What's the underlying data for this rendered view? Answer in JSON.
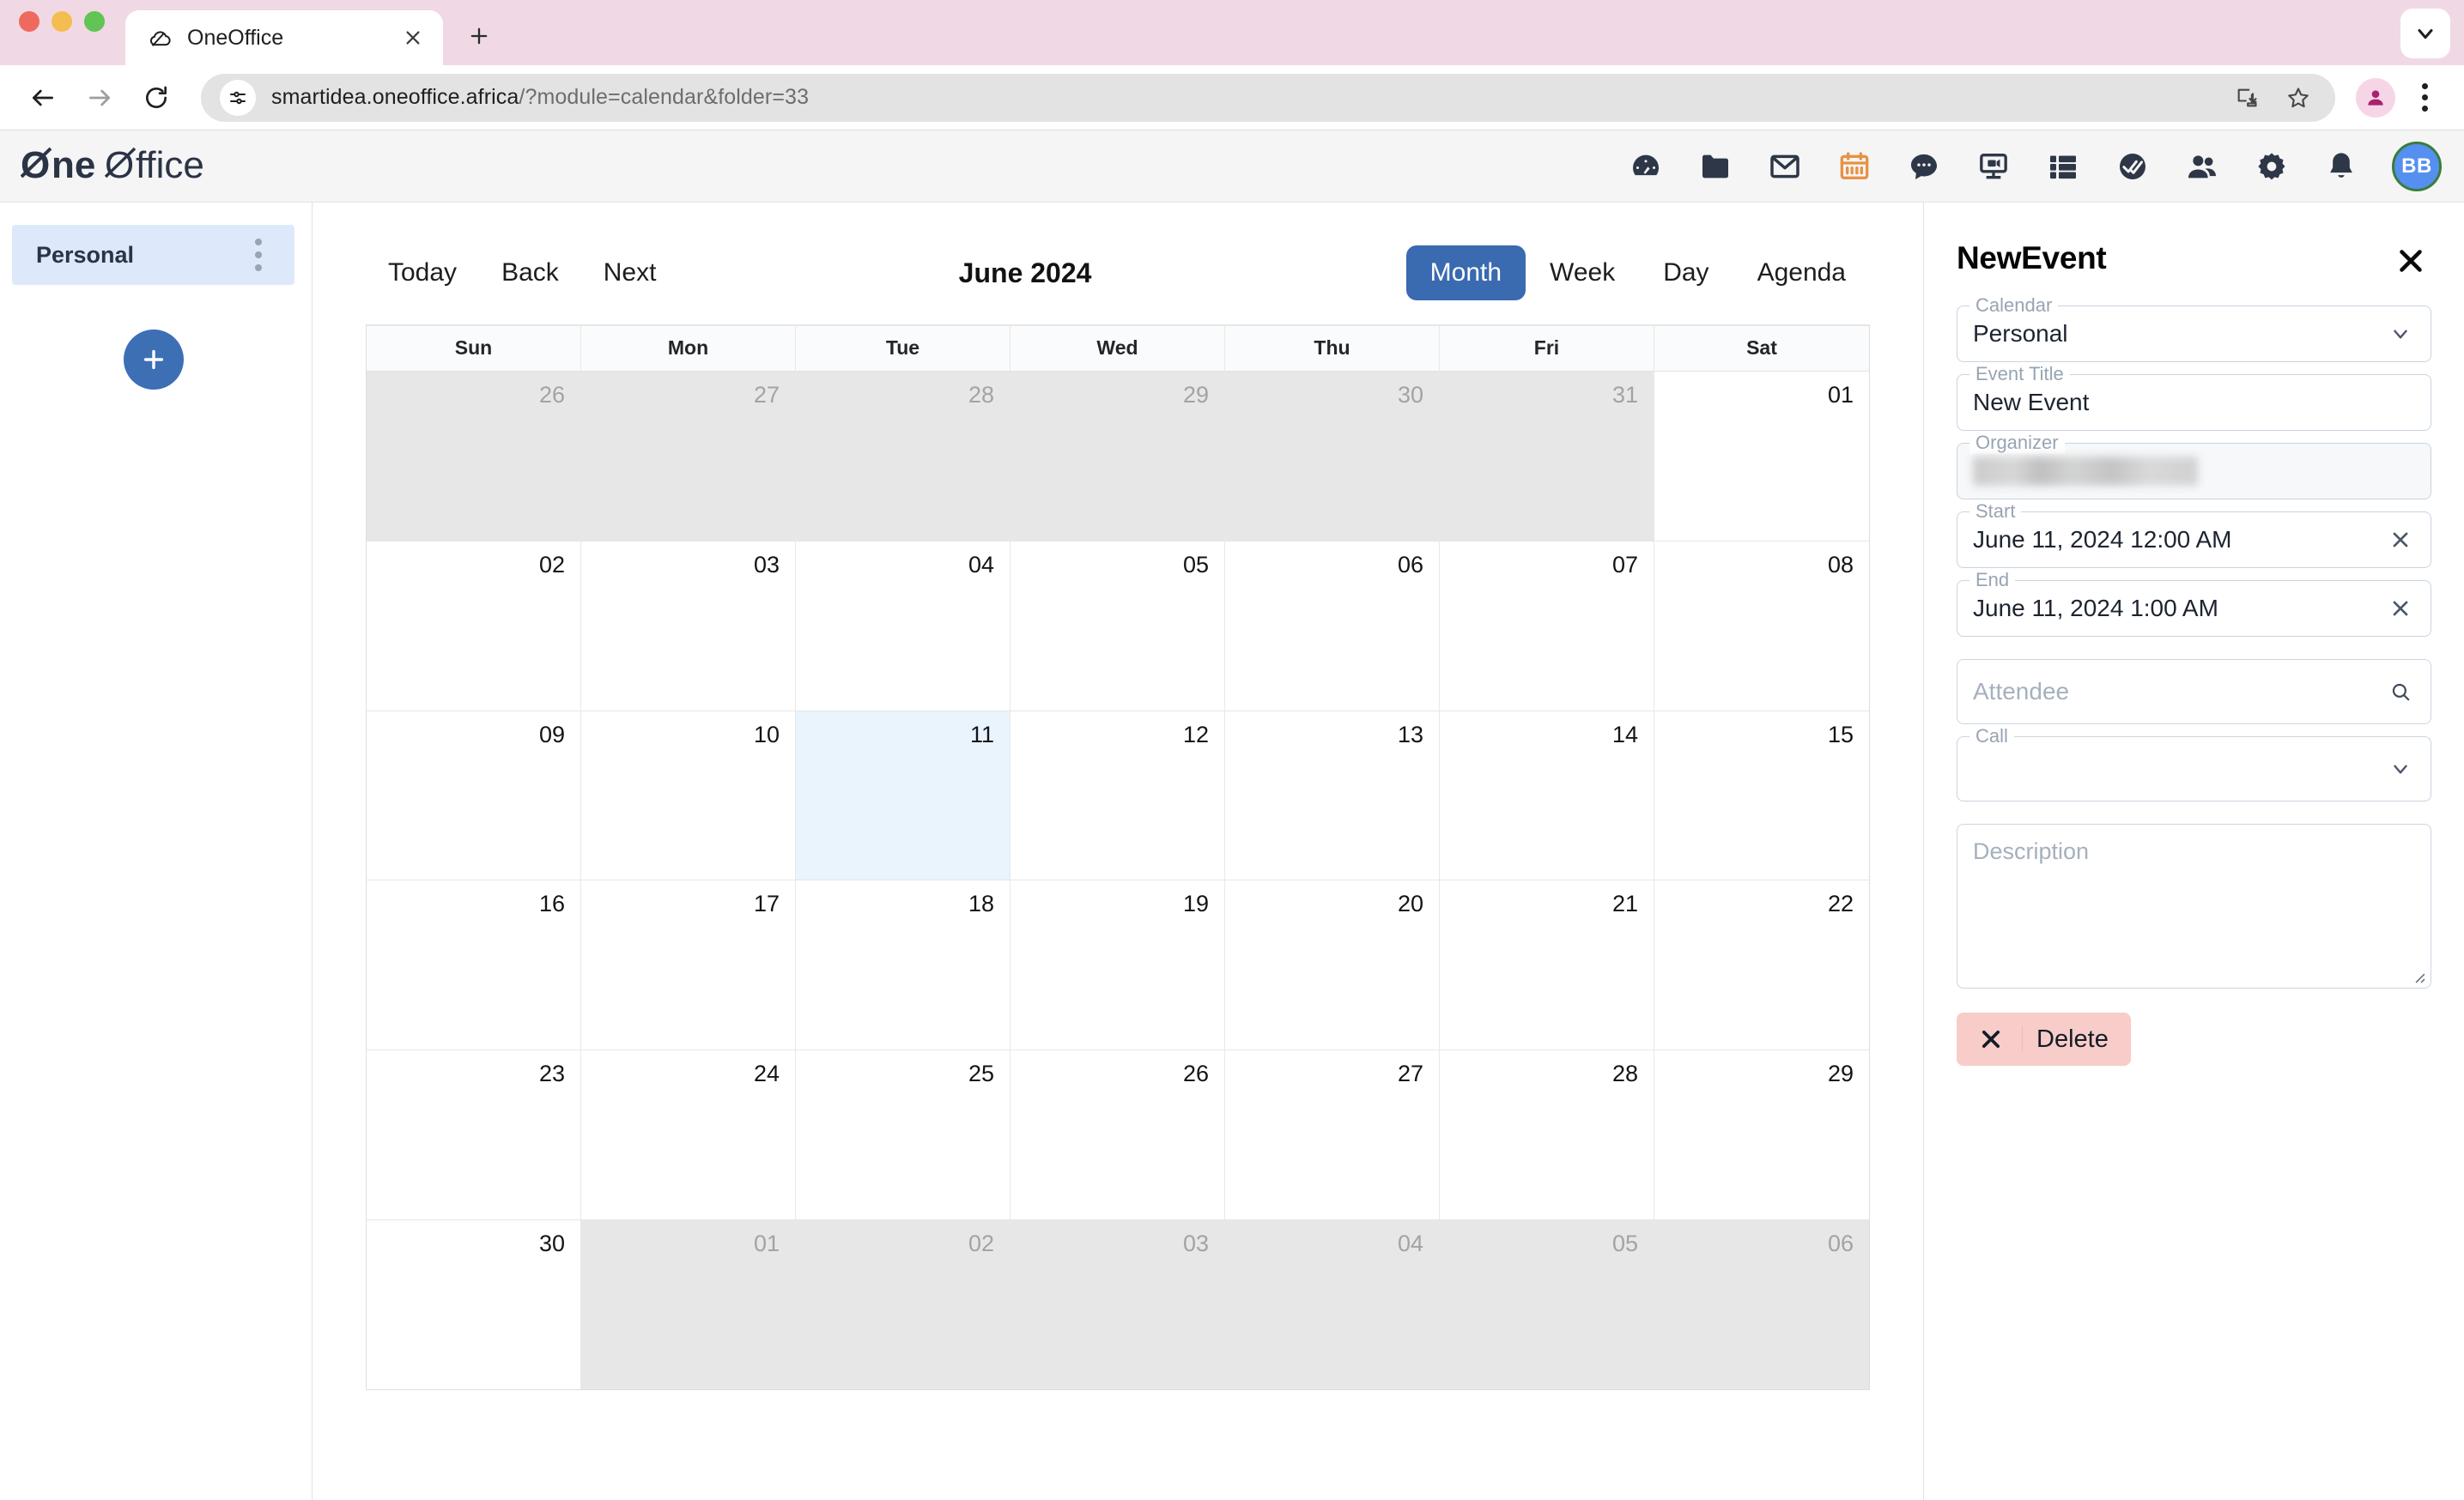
{
  "browser": {
    "tab": {
      "title": "OneOffice",
      "favicon_icon": "cloud-slash-icon",
      "close_icon": "close-icon"
    },
    "new_tab_icon": "plus-icon",
    "tab_list_icon": "chevron-down-icon",
    "back_icon": "arrow-left-icon",
    "forward_icon": "arrow-right-icon",
    "reload_icon": "reload-icon",
    "site_info_icon": "tune-icon",
    "url": {
      "domain": "smartidea.oneoffice.africa",
      "rest": "/?module=calendar&folder=33"
    },
    "install_icon": "install-app-icon",
    "bookmark_icon": "star-icon",
    "profile_icon": "person-icon",
    "menu_icon": "kebab-menu-icon"
  },
  "app_header": {
    "brand": "OneOffice",
    "icons": [
      {
        "name": "dashboard-icon",
        "label": "Dashboard",
        "active": false
      },
      {
        "name": "files-icon",
        "label": "Files",
        "active": false
      },
      {
        "name": "mail-icon",
        "label": "Mail",
        "active": false
      },
      {
        "name": "calendar-icon",
        "label": "Calendar",
        "active": true
      },
      {
        "name": "chat-icon",
        "label": "Chat",
        "active": false
      },
      {
        "name": "webinar-icon",
        "label": "Webinar",
        "active": false
      },
      {
        "name": "boards-icon",
        "label": "Boards",
        "active": false
      },
      {
        "name": "tasks-done-icon",
        "label": "Tasks",
        "active": false
      },
      {
        "name": "contacts-icon",
        "label": "Contacts",
        "active": false
      },
      {
        "name": "settings-icon",
        "label": "Settings",
        "active": false
      },
      {
        "name": "notifications-icon",
        "label": "Notifications",
        "active": false
      }
    ],
    "avatar_initials": "BB"
  },
  "sidebar": {
    "calendars": [
      {
        "label": "Personal",
        "selected": true,
        "menu_icon": "kebab-menu-icon"
      }
    ],
    "add_button_icon": "plus-icon"
  },
  "calendar": {
    "toolbar": {
      "today": "Today",
      "back": "Back",
      "next": "Next",
      "title": "June 2024",
      "views": [
        {
          "label": "Month",
          "active": true
        },
        {
          "label": "Week",
          "active": false
        },
        {
          "label": "Day",
          "active": false
        },
        {
          "label": "Agenda",
          "active": false
        }
      ]
    },
    "day_headers": [
      "Sun",
      "Mon",
      "Tue",
      "Wed",
      "Thu",
      "Fri",
      "Sat"
    ],
    "weeks": [
      [
        {
          "d": "26",
          "off": true
        },
        {
          "d": "27",
          "off": true
        },
        {
          "d": "28",
          "off": true
        },
        {
          "d": "29",
          "off": true
        },
        {
          "d": "30",
          "off": true
        },
        {
          "d": "31",
          "off": true
        },
        {
          "d": "01",
          "off": false
        }
      ],
      [
        {
          "d": "02",
          "off": false
        },
        {
          "d": "03",
          "off": false
        },
        {
          "d": "04",
          "off": false
        },
        {
          "d": "05",
          "off": false
        },
        {
          "d": "06",
          "off": false
        },
        {
          "d": "07",
          "off": false
        },
        {
          "d": "08",
          "off": false
        }
      ],
      [
        {
          "d": "09",
          "off": false
        },
        {
          "d": "10",
          "off": false
        },
        {
          "d": "11",
          "off": false,
          "today": true
        },
        {
          "d": "12",
          "off": false
        },
        {
          "d": "13",
          "off": false
        },
        {
          "d": "14",
          "off": false
        },
        {
          "d": "15",
          "off": false
        }
      ],
      [
        {
          "d": "16",
          "off": false
        },
        {
          "d": "17",
          "off": false
        },
        {
          "d": "18",
          "off": false
        },
        {
          "d": "19",
          "off": false
        },
        {
          "d": "20",
          "off": false
        },
        {
          "d": "21",
          "off": false
        },
        {
          "d": "22",
          "off": false
        }
      ],
      [
        {
          "d": "23",
          "off": false
        },
        {
          "d": "24",
          "off": false
        },
        {
          "d": "25",
          "off": false
        },
        {
          "d": "26",
          "off": false
        },
        {
          "d": "27",
          "off": false
        },
        {
          "d": "28",
          "off": false
        },
        {
          "d": "29",
          "off": false
        }
      ],
      [
        {
          "d": "30",
          "off": false
        },
        {
          "d": "01",
          "off": true
        },
        {
          "d": "02",
          "off": true
        },
        {
          "d": "03",
          "off": true
        },
        {
          "d": "04",
          "off": true
        },
        {
          "d": "05",
          "off": true
        },
        {
          "d": "06",
          "off": true
        }
      ]
    ]
  },
  "event_panel": {
    "title": "NewEvent",
    "close_icon": "close-icon",
    "calendar_label": "Calendar",
    "calendar_value": "Personal",
    "calendar_dropdown_icon": "chevron-down-icon",
    "event_title_label": "Event Title",
    "event_title_value": "New Event",
    "organizer_label": "Organizer",
    "organizer_value": "",
    "start_label": "Start",
    "start_value": "June 11, 2024 12:00 AM",
    "start_clear_icon": "close-icon",
    "end_label": "End",
    "end_value": "June 11, 2024 1:00 AM",
    "end_clear_icon": "close-icon",
    "attendee_placeholder": "Attendee",
    "attendee_search_icon": "search-icon",
    "call_label": "Call",
    "call_value": "",
    "call_dropdown_icon": "chevron-down-icon",
    "description_placeholder": "Description",
    "delete_label": "Delete",
    "delete_icon": "close-icon"
  },
  "colors": {
    "accent_blue": "#3a6ab0",
    "today_highlight": "#e9f4fd",
    "sidebar_selected": "#dde8fa",
    "delete_bg": "#f7ccc9",
    "calendar_icon_orange": "#e89243",
    "tabstrip_pink": "#f0d9e4"
  }
}
